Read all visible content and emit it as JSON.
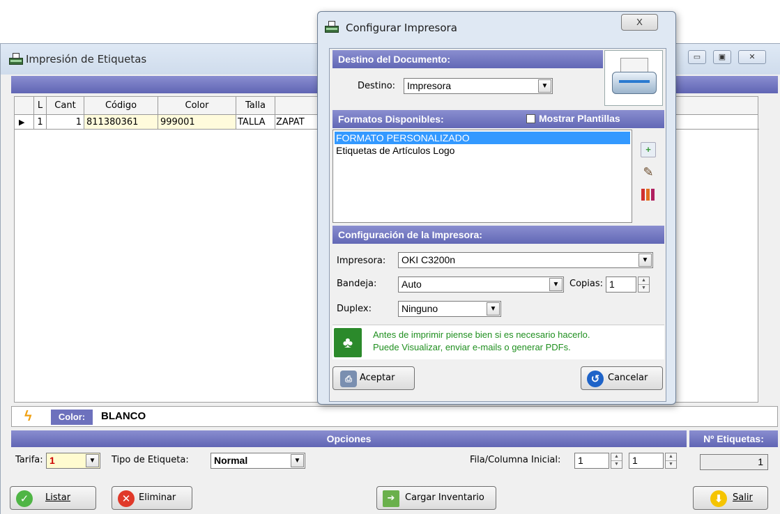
{
  "main_window": {
    "title": "Impresión de Etiquetas",
    "grid": {
      "columns": [
        "L",
        "Cant",
        "Código",
        "Color",
        "Talla"
      ],
      "rows": [
        {
          "l": "1",
          "cant": "1",
          "codigo": "811380361",
          "color": "999001",
          "talla": "TALLA",
          "extra": "ZAPAT"
        }
      ]
    },
    "color_bar": {
      "label": "Color:",
      "value": "BLANCO"
    },
    "options": {
      "header": "Opciones",
      "labels_header": "Nº Etiquetas:",
      "tarifa_label": "Tarifa:",
      "tarifa_value": "1",
      "tipo_label": "Tipo de Etiqueta:",
      "tipo_value": "Normal",
      "fila_label": "Fila/Columna Inicial:",
      "fila_value": "1",
      "columna_value": "1",
      "count_value": "1"
    },
    "buttons": {
      "listar": "Listar",
      "eliminar": "Eliminar",
      "cargar": "Cargar Inventario",
      "salir": "Salir"
    }
  },
  "dialog": {
    "title": "Configurar Impresora",
    "close": "X",
    "destino_header": "Destino del Documento:",
    "destino_label": "Destino:",
    "destino_value": "Impresora",
    "formatos_header": "Formatos Disponibles:",
    "mostrar_plantillas": "Mostrar Plantillas",
    "formatos": [
      "FORMATO PERSONALIZADO",
      "Etiquetas de Artículos Logo"
    ],
    "config_header": "Configuración de la Impresora:",
    "impresora_label": "Impresora:",
    "impresora_value": "OKI C3200n",
    "bandeja_label": "Bandeja:",
    "bandeja_value": "Auto",
    "copias_label": "Copias:",
    "copias_value": "1",
    "duplex_label": "Duplex:",
    "duplex_value": "Ninguno",
    "eco_line1": "Antes de imprimir piense bien si es necesario hacerlo.",
    "eco_line2": "Puede Visualizar, enviar e-mails o generar PDFs.",
    "aceptar": "Aceptar",
    "cancelar": "Cancelar"
  },
  "colors": {
    "section_bar": "#6d71bd",
    "selection": "#3399ff",
    "eco_text": "#1f8f1f"
  }
}
